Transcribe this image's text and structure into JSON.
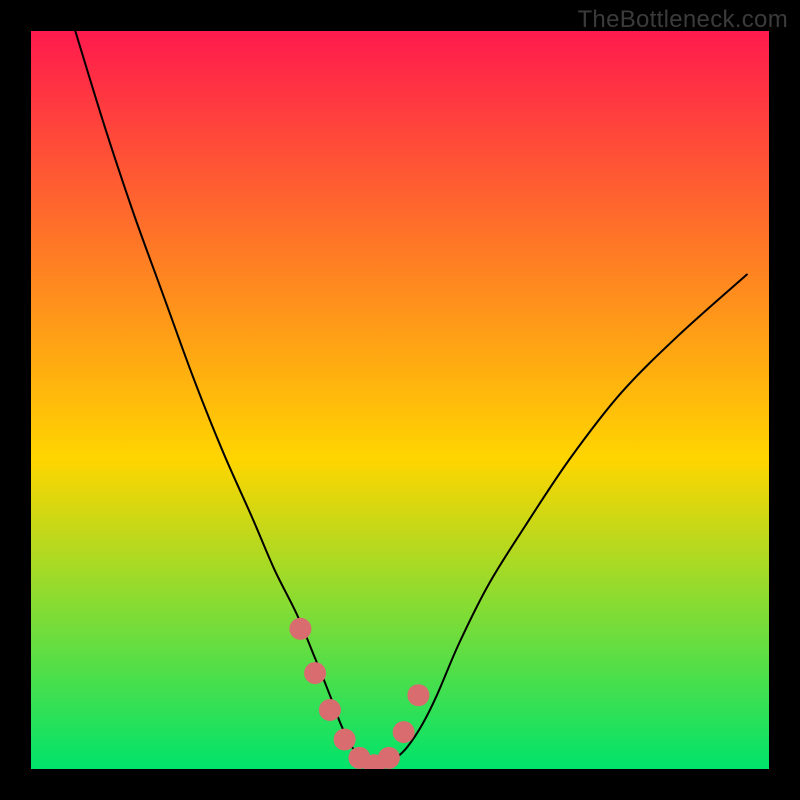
{
  "watermark": {
    "text": "TheBottleneck.com"
  },
  "chart_data": {
    "type": "line",
    "title": "",
    "xlabel": "",
    "ylabel": "",
    "xlim": [
      0,
      100
    ],
    "ylim": [
      0,
      100
    ],
    "background_gradient": {
      "top_color": "#ff1a4d",
      "mid_color": "#ffd500",
      "bottom_color": "#00e36b"
    },
    "series": [
      {
        "name": "bottleneck-curve",
        "x": [
          6,
          10,
          14,
          18,
          22,
          26,
          30,
          33,
          36,
          38.5,
          40.5,
          42,
          43.5,
          45,
          46.5,
          48,
          49.5,
          51,
          53,
          55,
          58,
          62,
          67,
          73,
          80,
          88,
          97
        ],
        "y": [
          100,
          87,
          75,
          64,
          53,
          43,
          34,
          27,
          21,
          15,
          10,
          6,
          3,
          1,
          0,
          0.5,
          1.5,
          3,
          6,
          10,
          17,
          25,
          33,
          42,
          51,
          59,
          67
        ],
        "note": "x and y are in percent of plot area, origin bottom-left"
      }
    ],
    "markers": {
      "name": "highlighted-bottom-points",
      "color": "#d96c6f",
      "x": [
        36.5,
        38.5,
        40.5,
        42.5,
        44.5,
        46.5,
        48.5,
        50.5,
        52.5
      ],
      "y": [
        19,
        13,
        8,
        4,
        1.5,
        0.5,
        1.5,
        5,
        10
      ],
      "note": "percent of plot area, origin bottom-left"
    }
  }
}
